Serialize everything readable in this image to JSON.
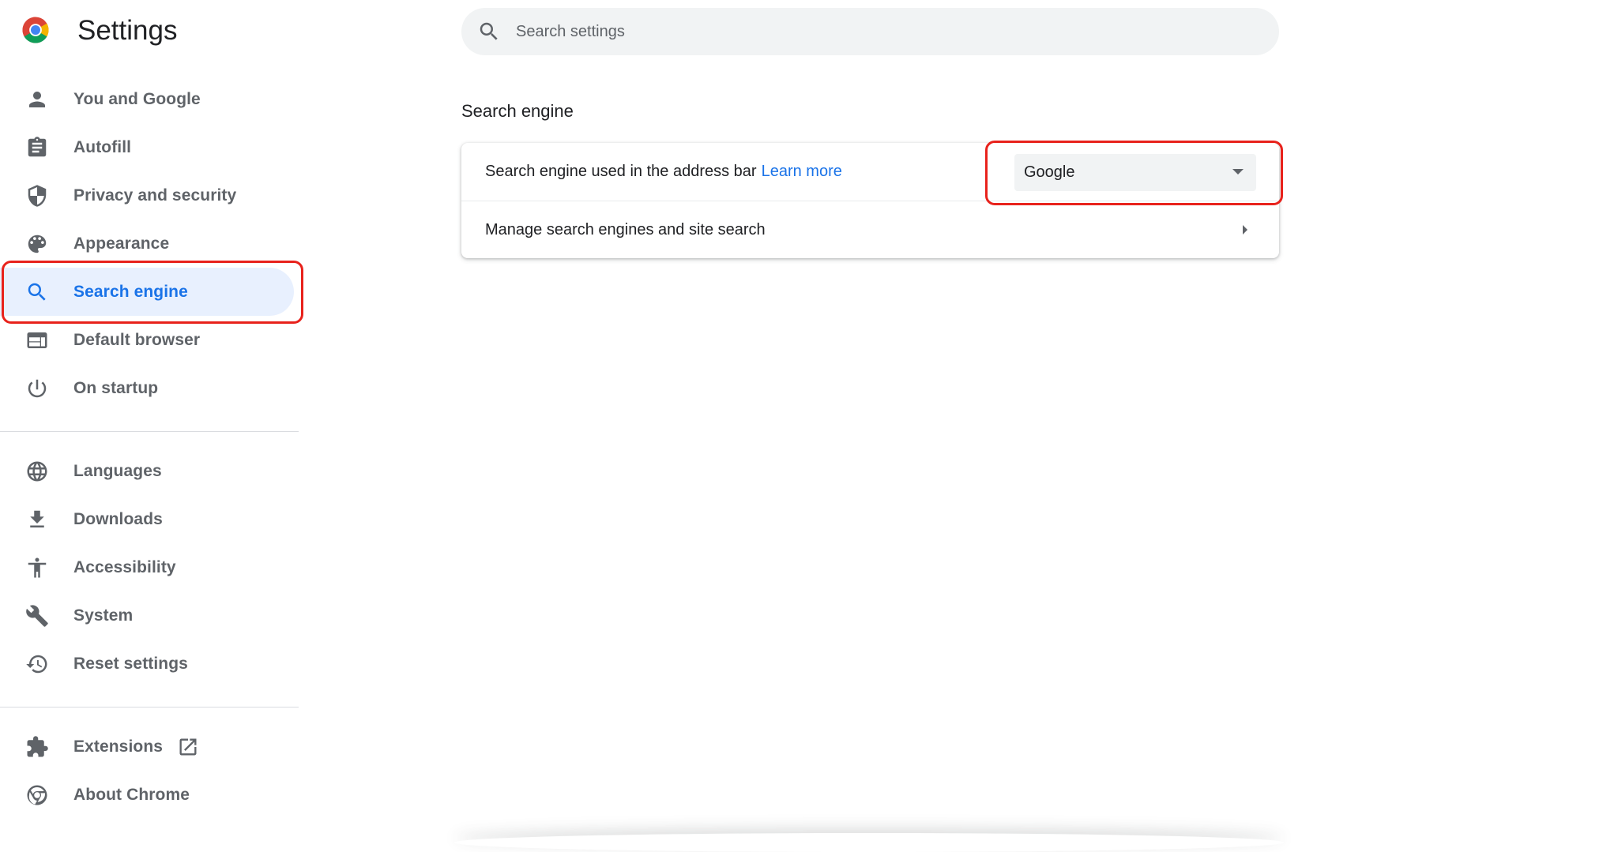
{
  "app": {
    "title": "Settings",
    "logo_icon": "chrome-logo-icon"
  },
  "search": {
    "placeholder": "Search settings",
    "value": ""
  },
  "sidebar": {
    "groups": [
      [
        {
          "label": "You and Google",
          "icon": "person-icon"
        },
        {
          "label": "Autofill",
          "icon": "clipboard-icon"
        },
        {
          "label": "Privacy and security",
          "icon": "shield-icon"
        },
        {
          "label": "Appearance",
          "icon": "palette-icon"
        },
        {
          "label": "Search engine",
          "icon": "search-icon",
          "active": true
        },
        {
          "label": "Default browser",
          "icon": "browser-window-icon"
        },
        {
          "label": "On startup",
          "icon": "power-icon"
        }
      ],
      [
        {
          "label": "Languages",
          "icon": "globe-icon"
        },
        {
          "label": "Downloads",
          "icon": "download-icon"
        },
        {
          "label": "Accessibility",
          "icon": "accessibility-icon"
        },
        {
          "label": "System",
          "icon": "wrench-icon"
        },
        {
          "label": "Reset settings",
          "icon": "history-icon"
        }
      ],
      [
        {
          "label": "Extensions",
          "icon": "puzzle-icon",
          "external": true
        },
        {
          "label": "About Chrome",
          "icon": "chrome-icon"
        }
      ]
    ]
  },
  "main": {
    "section_title": "Search engine",
    "row1": {
      "label": "Search engine used in the address bar",
      "link": "Learn more",
      "selected": "Google"
    },
    "row2": {
      "label": "Manage search engines and site search"
    }
  },
  "colors": {
    "accent": "#1a73e8",
    "active_bg": "#e8f0fe",
    "highlight_ring": "#e8221c",
    "muted": "#5f6368"
  }
}
